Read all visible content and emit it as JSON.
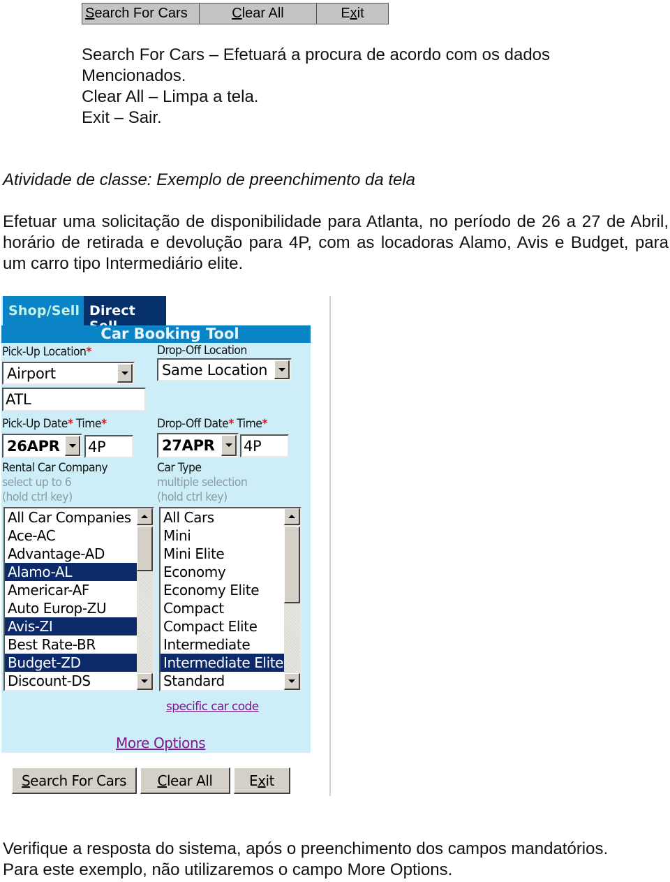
{
  "top_toolbar": {
    "buttons": [
      {
        "label_mnemonic": "S",
        "label_rest": "earch For Cars"
      },
      {
        "label_mnemonic": "C",
        "label_rest": "lear All"
      },
      {
        "label_pre": "E",
        "label_mnemonic": "x",
        "label_rest": "it"
      }
    ]
  },
  "description": {
    "lines": [
      "Search For Cars – Efetuará a procura de acordo com os dados",
      "Mencionados.",
      "Clear All – Limpa a tela.",
      "Exit – Sair."
    ]
  },
  "activity": {
    "title": "Atividade de classe: Exemplo de preenchimento da tela",
    "instruction": "Efetuar uma solicitação de disponibilidade para Atlanta, no período de 26 a 27 de Abril, horário de retirada e devolução para 4P, com as locadoras Alamo, Avis e Budget, para um carro tipo Intermediário elite."
  },
  "booking_tool": {
    "tabs": [
      {
        "label": "Shop/Sell",
        "active": true
      },
      {
        "label": "Direct Sell",
        "active": false
      }
    ],
    "title": "Car Booking Tool",
    "required_marker": "*",
    "pickup_location": {
      "label": "Pick-Up Location",
      "type_value": "Airport",
      "code_value": "ATL"
    },
    "dropoff_location": {
      "label": "Drop-Off Location",
      "value": "Same Location"
    },
    "pickup_date": {
      "date_label": "Pick-Up Date",
      "time_label": "Time",
      "date_value": "26APR",
      "time_value": "4P"
    },
    "dropoff_date": {
      "date_label": "Drop-Off Date",
      "time_label": "Time",
      "date_value": "27APR",
      "time_value": "4P"
    },
    "rental_company": {
      "label": "Rental Car Company",
      "hint1": "select up to 6",
      "hint2": "(hold ctrl key)",
      "items": [
        {
          "label": "All Car Companies",
          "selected": false
        },
        {
          "label": "Ace-AC",
          "selected": false
        },
        {
          "label": "Advantage-AD",
          "selected": false
        },
        {
          "label": "Alamo-AL",
          "selected": true
        },
        {
          "label": "Americar-AF",
          "selected": false
        },
        {
          "label": "Auto Europ-ZU",
          "selected": false
        },
        {
          "label": "Avis-ZI",
          "selected": true
        },
        {
          "label": "Best Rate-BR",
          "selected": false
        },
        {
          "label": "Budget-ZD",
          "selected": true
        },
        {
          "label": "Discount-DS",
          "selected": false
        }
      ]
    },
    "car_type": {
      "label": "Car Type",
      "hint1": "multiple selection",
      "hint2": "(hold ctrl key)",
      "items": [
        {
          "label": "All Cars",
          "selected": false
        },
        {
          "label": "Mini",
          "selected": false
        },
        {
          "label": "Mini Elite",
          "selected": false
        },
        {
          "label": "Economy",
          "selected": false
        },
        {
          "label": "Economy Elite",
          "selected": false
        },
        {
          "label": "Compact",
          "selected": false
        },
        {
          "label": "Compact Elite",
          "selected": false
        },
        {
          "label": "Intermediate",
          "selected": false
        },
        {
          "label": "Intermediate Elite",
          "selected": true
        },
        {
          "label": "Standard",
          "selected": false
        }
      ]
    },
    "specific_car_code_link": "specific car code",
    "more_options_link": "More Options",
    "buttons": [
      {
        "label_mnemonic": "S",
        "label_rest": "earch For Cars"
      },
      {
        "label_mnemonic": "C",
        "label_rest": "lear All"
      },
      {
        "label_pre": "E",
        "label_mnemonic": "x",
        "label_rest": "it"
      }
    ]
  },
  "footer": {
    "lines": [
      "Verifique a resposta do sistema, após o preenchimento dos campos mandatórios.",
      "Para este exemplo, não utilizaremos o campo More Options."
    ]
  },
  "colors": {
    "tab_active": "#0a84c6",
    "tab_inactive": "#06306a",
    "form_background": "#cdeef9",
    "selection": "#0c2a6a",
    "required": "#d01818",
    "link": "#7a1a8a"
  }
}
